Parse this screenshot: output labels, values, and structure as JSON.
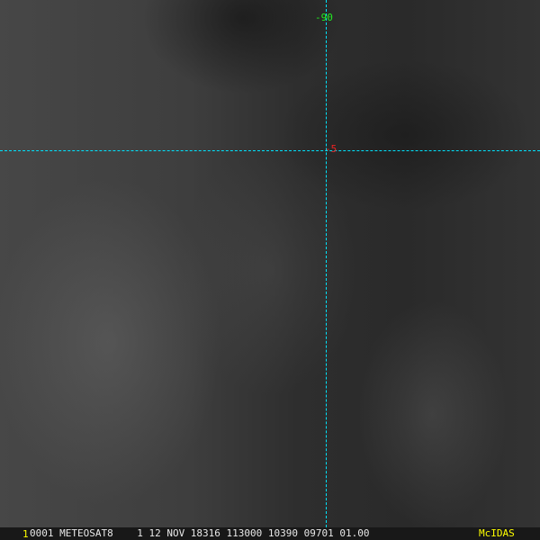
{
  "overlay": {
    "latitude_label": "-90",
    "longitude_label": "-5",
    "grid_color": "#00e5ff"
  },
  "status_bar": {
    "frame_number": "1",
    "info_text": "0001 METEOSAT8    1 12 NOV 18316 113000 10390 09701 01.00",
    "brand": "McIDAS"
  }
}
